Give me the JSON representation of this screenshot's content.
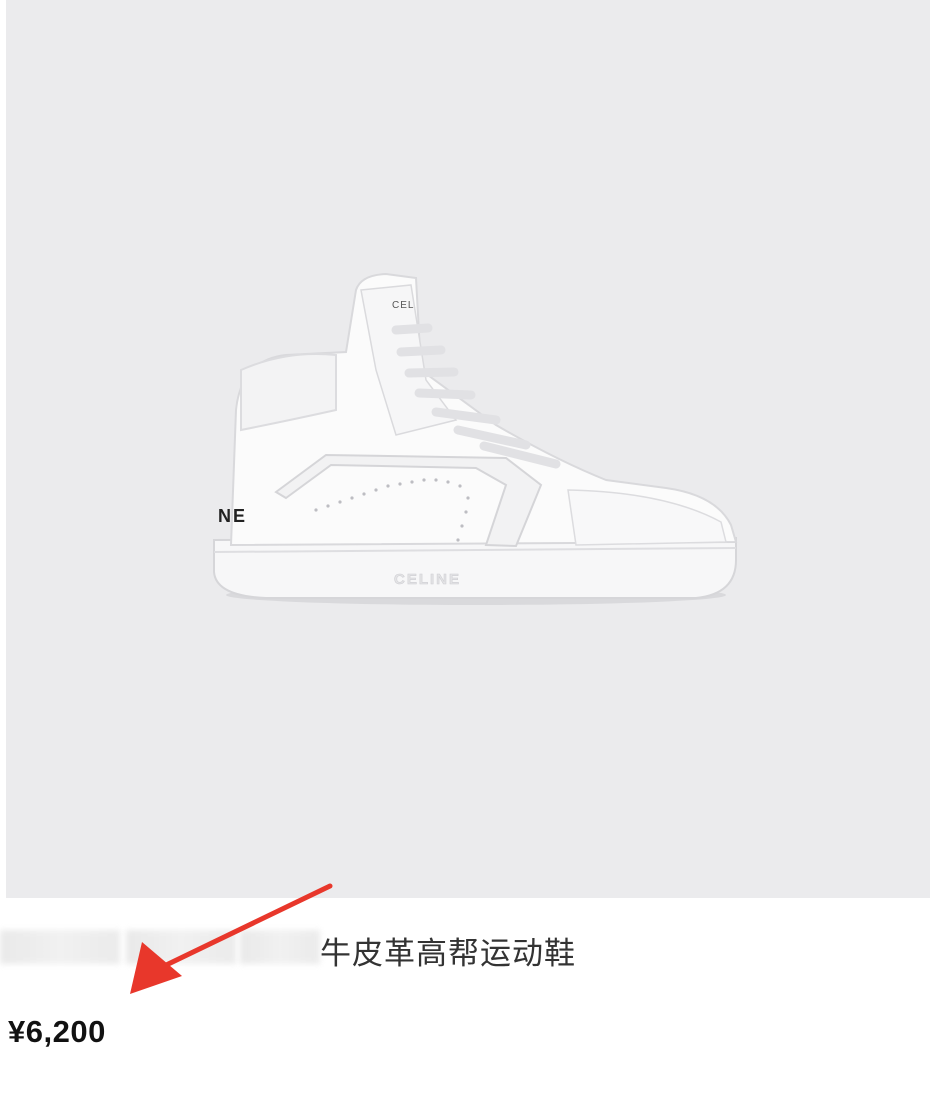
{
  "product": {
    "image_name": "white-high-top-sneaker",
    "logo_text": "CELINE",
    "title_visible": "牛皮革高帮运动鞋",
    "price": "¥6,200"
  },
  "colors": {
    "image_background": "#ebebed",
    "annotation_arrow": "#e8372b",
    "price_text": "#111111",
    "title_text": "#333333"
  }
}
